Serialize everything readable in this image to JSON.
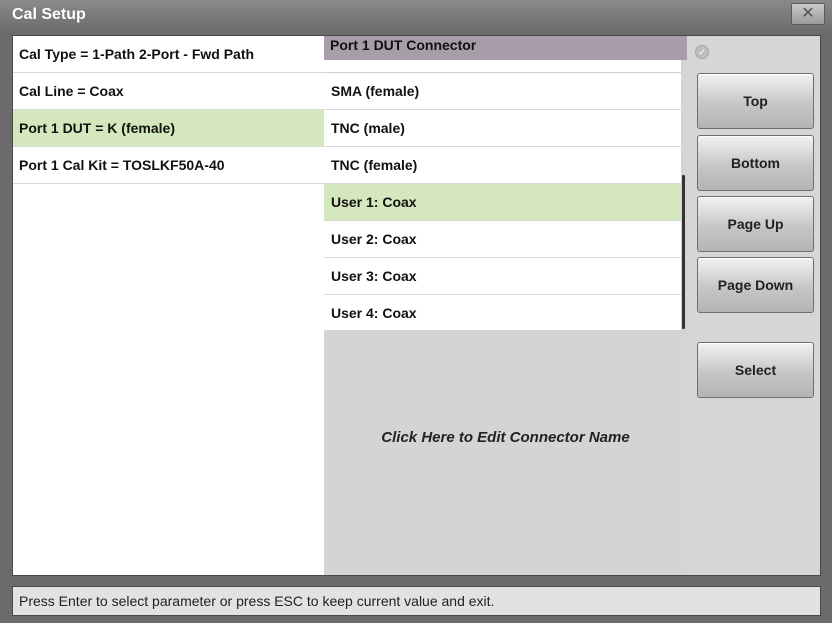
{
  "window": {
    "title": "Cal Setup",
    "close_label": "✕"
  },
  "parameters": [
    {
      "label": "Cal Type = 1-Path 2-Port - Fwd Path",
      "selected": false
    },
    {
      "label": "Cal Line = Coax",
      "selected": false
    },
    {
      "label": "Port 1 DUT = K (female)",
      "selected": true
    },
    {
      "label": "Port 1 Cal Kit = TOSLKF50A-40",
      "selected": false
    }
  ],
  "connector_list": {
    "header": "Port 1 DUT Connector",
    "options": [
      {
        "label": "SMA (female)",
        "selected": false
      },
      {
        "label": "TNC (male)",
        "selected": false
      },
      {
        "label": "TNC (female)",
        "selected": false
      },
      {
        "label": "User 1: Coax",
        "selected": true
      },
      {
        "label": "User 2: Coax",
        "selected": false
      },
      {
        "label": "User 3: Coax",
        "selected": false
      },
      {
        "label": "User 4: Coax",
        "selected": false
      }
    ],
    "edit_link": "Click Here to Edit Connector Name"
  },
  "buttons": {
    "top": "Top",
    "bottom": "Bottom",
    "page_up": "Page Up",
    "page_down": "Page Down",
    "select": "Select"
  },
  "icons": {
    "check": "check-circle-icon",
    "close": "close-icon"
  },
  "status": {
    "text": "Press Enter to select parameter or press ESC to keep current value and exit."
  },
  "colors": {
    "selected_row": "#d5e8bd",
    "header_bg": "#a79ea9",
    "titlebar": "#7a7a7a"
  }
}
